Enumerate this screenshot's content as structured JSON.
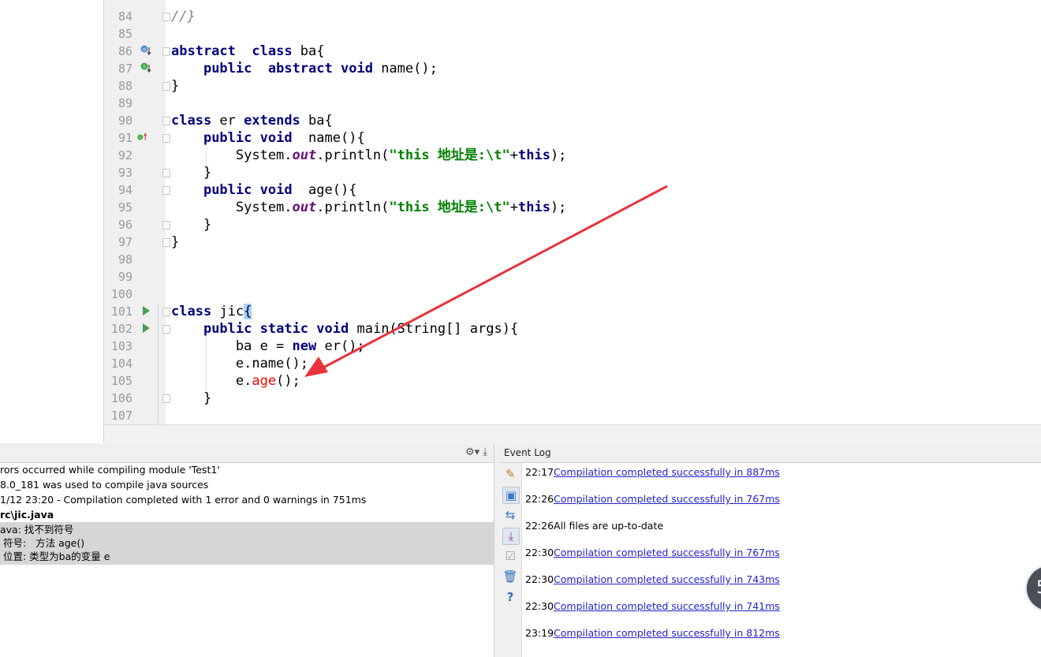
{
  "editor": {
    "lines": [
      {
        "num": "84",
        "tokens": [
          {
            "t": "//}",
            "c": "cmt"
          }
        ]
      },
      {
        "num": "85",
        "tokens": []
      },
      {
        "num": "86",
        "tokens": [
          {
            "t": "abstract",
            "c": "kw"
          },
          {
            "t": "  "
          },
          {
            "t": "class",
            "c": "kw"
          },
          {
            "t": " ba{"
          }
        ]
      },
      {
        "num": "87",
        "tokens": [
          {
            "t": "    "
          },
          {
            "t": "public",
            "c": "kw"
          },
          {
            "t": "  "
          },
          {
            "t": "abstract",
            "c": "kw"
          },
          {
            "t": " "
          },
          {
            "t": "void",
            "c": "kw"
          },
          {
            "t": " name();"
          }
        ]
      },
      {
        "num": "88",
        "tokens": [
          {
            "t": "}"
          }
        ]
      },
      {
        "num": "89",
        "tokens": []
      },
      {
        "num": "90",
        "tokens": [
          {
            "t": "class",
            "c": "kw"
          },
          {
            "t": " er "
          },
          {
            "t": "extends",
            "c": "kw"
          },
          {
            "t": " ba{"
          }
        ]
      },
      {
        "num": "91",
        "tokens": [
          {
            "t": "    "
          },
          {
            "t": "public",
            "c": "kw"
          },
          {
            "t": " "
          },
          {
            "t": "void",
            "c": "kw"
          },
          {
            "t": "  name(){"
          }
        ]
      },
      {
        "num": "92",
        "tokens": [
          {
            "t": "        System."
          },
          {
            "t": "out",
            "c": "fld"
          },
          {
            "t": ".println("
          },
          {
            "t": "\"this 地址是:\\t\"",
            "c": "str"
          },
          {
            "t": "+"
          },
          {
            "t": "this",
            "c": "kw"
          },
          {
            "t": ");"
          }
        ]
      },
      {
        "num": "93",
        "tokens": [
          {
            "t": "    }"
          }
        ]
      },
      {
        "num": "94",
        "tokens": [
          {
            "t": "    "
          },
          {
            "t": "public",
            "c": "kw"
          },
          {
            "t": " "
          },
          {
            "t": "void",
            "c": "kw"
          },
          {
            "t": "  age(){"
          }
        ]
      },
      {
        "num": "95",
        "tokens": [
          {
            "t": "        System."
          },
          {
            "t": "out",
            "c": "fld"
          },
          {
            "t": ".println("
          },
          {
            "t": "\"this 地址是:\\t\"",
            "c": "str"
          },
          {
            "t": "+"
          },
          {
            "t": "this",
            "c": "kw"
          },
          {
            "t": ");"
          }
        ]
      },
      {
        "num": "96",
        "tokens": [
          {
            "t": "    }"
          }
        ]
      },
      {
        "num": "97",
        "tokens": [
          {
            "t": "}"
          }
        ]
      },
      {
        "num": "98",
        "tokens": []
      },
      {
        "num": "99",
        "tokens": []
      },
      {
        "num": "100",
        "tokens": []
      },
      {
        "num": "101",
        "tokens": [
          {
            "t": "class",
            "c": "kw"
          },
          {
            "t": " jic"
          },
          {
            "t": "{",
            "c": "brace-hl"
          }
        ]
      },
      {
        "num": "102",
        "tokens": [
          {
            "t": "    "
          },
          {
            "t": "public",
            "c": "kw"
          },
          {
            "t": " "
          },
          {
            "t": "static",
            "c": "kw"
          },
          {
            "t": " "
          },
          {
            "t": "void",
            "c": "kw"
          },
          {
            "t": " main(String[] args){"
          }
        ]
      },
      {
        "num": "103",
        "tokens": [
          {
            "t": "        ba e = "
          },
          {
            "t": "new",
            "c": "kw"
          },
          {
            "t": " er();"
          }
        ]
      },
      {
        "num": "104",
        "tokens": [
          {
            "t": "        e.name();"
          }
        ]
      },
      {
        "num": "105",
        "tokens": [
          {
            "t": "        e."
          },
          {
            "t": "age",
            "c": "err"
          },
          {
            "t": "();"
          }
        ]
      },
      {
        "num": "106",
        "tokens": [
          {
            "t": "    }"
          }
        ]
      },
      {
        "num": "107",
        "tokens": []
      }
    ]
  },
  "messages": {
    "lines": [
      "rors occurred while compiling module 'Test1'",
      "8.0_181 was used to compile java sources",
      "1/12 23:20 - Compilation completed with 1 error and 0 warnings in 751ms",
      "rc\\jic.java",
      "ava: 找不到符号",
      " 符号:   方法 age()",
      " 位置: 类型为ba的变量 e"
    ]
  },
  "event_log": {
    "title": "Event Log",
    "entries": [
      {
        "time": "22:17",
        "text": "Compilation completed successfully in 887ms",
        "link": true
      },
      {
        "time": "22:26",
        "text": "Compilation completed successfully in 767ms",
        "link": true
      },
      {
        "time": "22:26",
        "text": "All files are up-to-date",
        "link": false
      },
      {
        "time": "22:30",
        "text": "Compilation completed successfully in 767ms",
        "link": true
      },
      {
        "time": "22:30",
        "text": "Compilation completed successfully in 743ms",
        "link": true
      },
      {
        "time": "22:30",
        "text": "Compilation completed successfully in 741ms",
        "link": true
      },
      {
        "time": "23:19",
        "text": "Compilation completed successfully in 812ms",
        "link": true
      }
    ]
  },
  "floating_button": {
    "label": "5"
  },
  "colors": {
    "arrow": "#e8333a",
    "keyword": "#000080",
    "string": "#008000",
    "error": "#ff0000",
    "link": "#2222cc"
  }
}
